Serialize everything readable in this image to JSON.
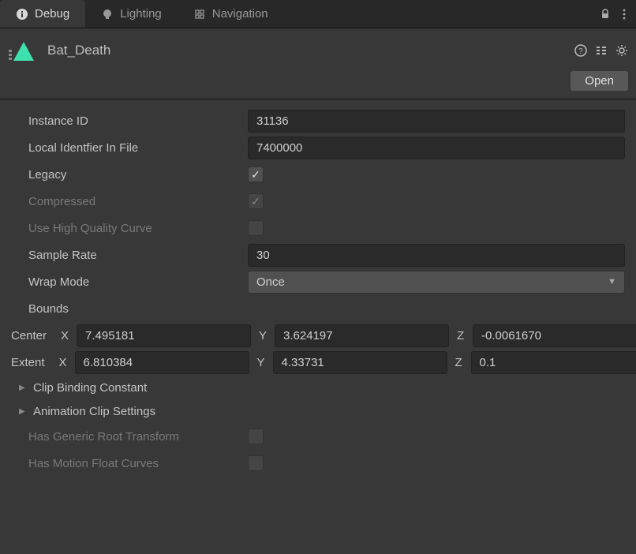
{
  "tabs": {
    "debug": "Debug",
    "lighting": "Lighting",
    "navigation": "Navigation"
  },
  "asset": {
    "name": "Bat_Death"
  },
  "buttons": {
    "open": "Open"
  },
  "props": {
    "instanceId": {
      "label": "Instance ID",
      "value": "31136"
    },
    "localId": {
      "label": "Local Identfier In File",
      "value": "7400000"
    },
    "legacy": {
      "label": "Legacy"
    },
    "compressed": {
      "label": "Compressed"
    },
    "useHQCurve": {
      "label": "Use High Quality Curve"
    },
    "sampleRate": {
      "label": "Sample Rate",
      "value": "30"
    },
    "wrapMode": {
      "label": "Wrap Mode",
      "value": "Once"
    },
    "bounds": {
      "label": "Bounds",
      "centerLabel": "Center",
      "extentLabel": "Extent",
      "center": {
        "x": "7.495181",
        "y": "3.624197",
        "z": "-0.0061670"
      },
      "extent": {
        "x": "6.810384",
        "y": "4.33731",
        "z": "0.1"
      }
    },
    "clipBinding": "Clip Binding Constant",
    "animSettings": "Animation Clip Settings",
    "hasGenericRoot": {
      "label": "Has Generic Root Transform"
    },
    "hasMotionFloat": {
      "label": "Has Motion Float Curves"
    }
  },
  "axis": {
    "x": "X",
    "y": "Y",
    "z": "Z"
  }
}
